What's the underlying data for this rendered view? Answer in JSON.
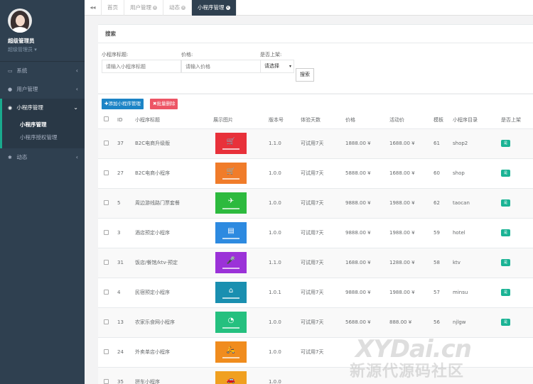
{
  "user": {
    "name": "超级管理员",
    "role": "超级管理员 ▾"
  },
  "sidebar": {
    "items": [
      {
        "icon": "monitor-icon",
        "label": "系统"
      },
      {
        "icon": "user-icon",
        "label": "用户管理"
      },
      {
        "icon": "chat-icon",
        "label": "小程序管理"
      },
      {
        "icon": "cogs-icon",
        "label": "动态"
      }
    ],
    "sub_items": [
      {
        "label": "小程序管理"
      },
      {
        "label": "小程序授权管理"
      }
    ]
  },
  "tabs": [
    {
      "label": "首页"
    },
    {
      "label": "用户管理"
    },
    {
      "label": "动态"
    },
    {
      "label": "小程序管理"
    }
  ],
  "search": {
    "title": "搜索",
    "title_label": "小程序标题:",
    "title_placeholder": "请输入小程序标题",
    "price_label": "价格:",
    "price_placeholder": "请输入价格",
    "shelf_label": "是否上架:",
    "shelf_value": "请选择",
    "button": "搜索"
  },
  "actions": {
    "add": "✚添加小程序管理",
    "delete": "✖批量删除"
  },
  "table": {
    "headers": [
      "ID",
      "小程序标题",
      "展示图片",
      "版本号",
      "体验天数",
      "价格",
      "活动价",
      "模板",
      "小程序目录",
      "是否上架"
    ],
    "rows": [
      {
        "id": "37",
        "title": "B2C电商升级版",
        "version": "1.1.0",
        "trial": "可试用7天",
        "price": "1888.00 ¥",
        "promo": "1688.00 ¥",
        "template": "61",
        "dir": "shop2",
        "badge": "是",
        "color": "#e8313a",
        "glyph": "🛒",
        "icon": "cart-icon"
      },
      {
        "id": "27",
        "title": "B2C电商小程序",
        "version": "1.0.0",
        "trial": "可试用7天",
        "price": "5888.00 ¥",
        "promo": "1688.00 ¥",
        "template": "60",
        "dir": "shop",
        "badge": "是",
        "color": "#f07c2a",
        "glyph": "🛒",
        "icon": "cart-icon"
      },
      {
        "id": "5",
        "title": "周边游线路门票套餐",
        "version": "1.0.0",
        "trial": "可试用7天",
        "price": "9888.00 ¥",
        "promo": "1988.00 ¥",
        "template": "62",
        "dir": "taocan",
        "badge": "是",
        "color": "#2dba3e",
        "glyph": "✈",
        "icon": "travel-icon"
      },
      {
        "id": "3",
        "title": "酒店预定小程序",
        "version": "1.0.0",
        "trial": "可试用7天",
        "price": "9888.00 ¥",
        "promo": "1988.00 ¥",
        "template": "59",
        "dir": "hotel",
        "badge": "是",
        "color": "#2d8ae0",
        "glyph": "▤",
        "icon": "hotel-icon"
      },
      {
        "id": "31",
        "title": "饭店/餐馆/ktv-预定",
        "version": "1.1.0",
        "trial": "可试用7天",
        "price": "1688.00 ¥",
        "promo": "1288.00 ¥",
        "template": "58",
        "dir": "ktv",
        "badge": "是",
        "color": "#9b32d8",
        "glyph": "🎤",
        "icon": "microphone-icon"
      },
      {
        "id": "4",
        "title": "民宿预定小程序",
        "version": "1.0.1",
        "trial": "可试用7天",
        "price": "9888.00 ¥",
        "promo": "1988.00 ¥",
        "template": "57",
        "dir": "minsu",
        "badge": "是",
        "color": "#1a8fb0",
        "glyph": "⌂",
        "icon": "house-icon"
      },
      {
        "id": "13",
        "title": "农家乐食网小程序",
        "version": "1.0.0",
        "trial": "可试用7天",
        "price": "5688.00 ¥",
        "promo": "888.00 ¥",
        "template": "56",
        "dir": "njlgw",
        "badge": "是",
        "color": "#25c07f",
        "glyph": "◔",
        "icon": "chart-icon"
      },
      {
        "id": "24",
        "title": "外卖单店小程序",
        "version": "1.0.0",
        "trial": "可试用7天",
        "price": "",
        "promo": "",
        "template": "",
        "dir": "",
        "badge": "",
        "color": "#f08c1e",
        "glyph": "🛵",
        "icon": "delivery-icon"
      },
      {
        "id": "35",
        "title": "拼车小程序",
        "version": "1.0.0",
        "trial": "",
        "price": "",
        "promo": "",
        "template": "",
        "dir": "",
        "badge": "",
        "color": "#f0a020",
        "glyph": "🚗",
        "icon": "car-icon"
      }
    ]
  },
  "watermark": {
    "line1": "XYDai.cn",
    "line2": "新源代源码社区"
  }
}
